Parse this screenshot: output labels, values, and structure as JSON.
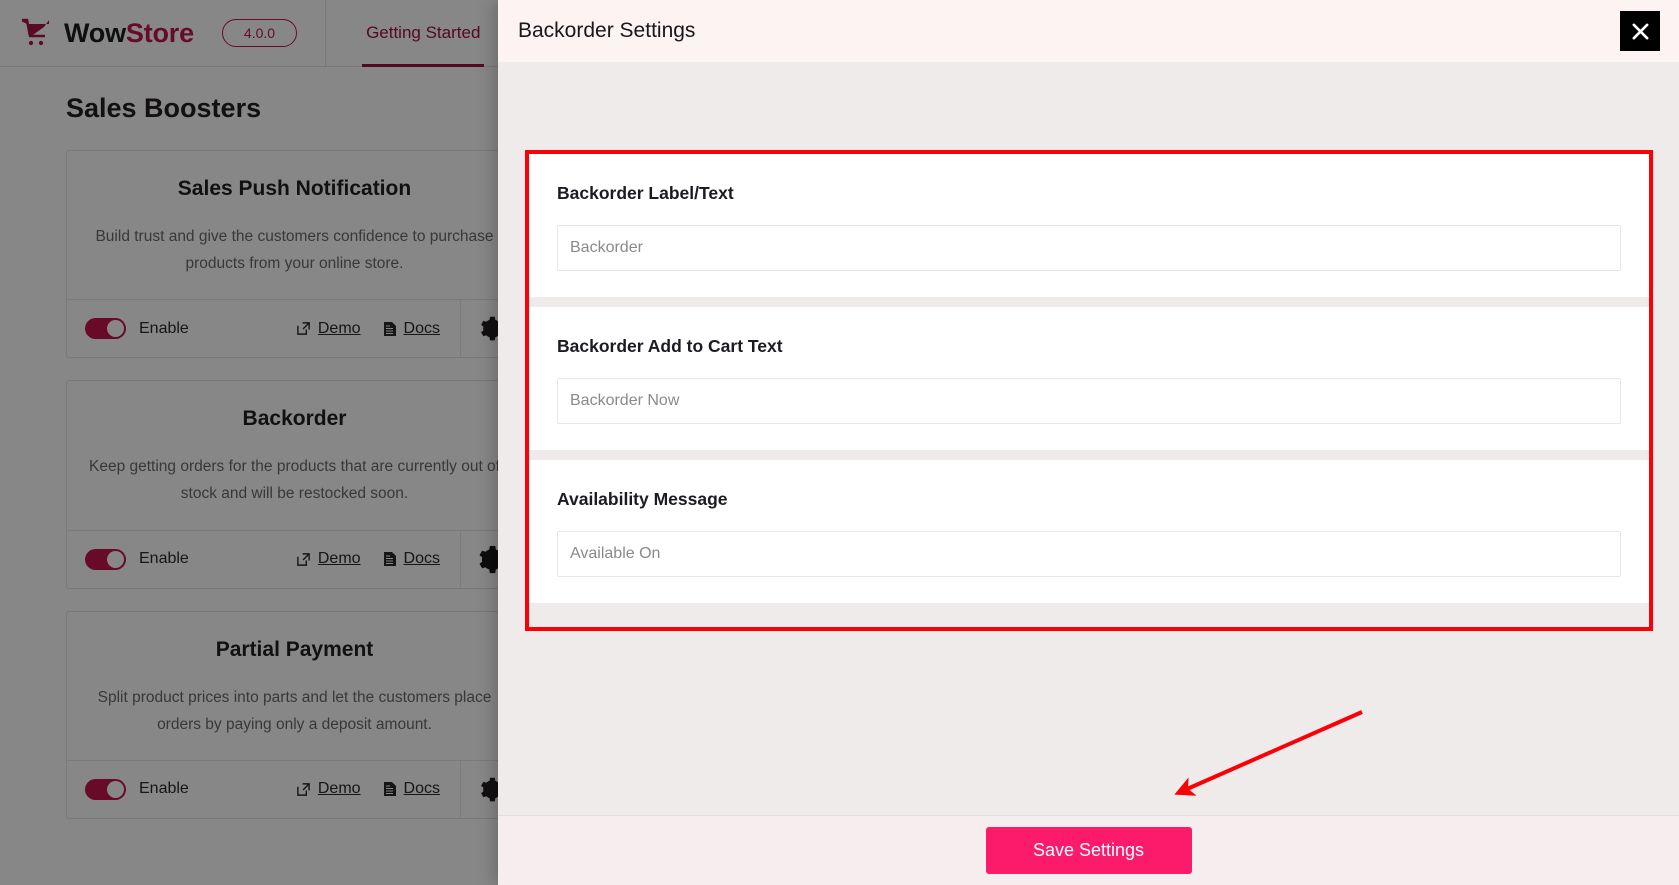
{
  "app": {
    "brand_prefix": "Wow",
    "brand_suffix": "Store",
    "version": "4.0.0",
    "logo_icon": "shopping-cart-icon",
    "nav_tabs": [
      {
        "label": "Getting Started",
        "active": true
      }
    ],
    "page_title": "Sales Boosters",
    "cards": [
      {
        "title": "Sales Push Notification",
        "description": "Build trust and give the customers confidence to purchase products from your online store.",
        "toggle_label": "Enable",
        "toggle_on": true,
        "demo_label": "Demo",
        "docs_label": "Docs",
        "demo_icon": "external-link-icon",
        "docs_icon": "document-icon",
        "settings_icon": "gear-icon"
      },
      {
        "title": "Backorder",
        "description": "Keep getting orders for the products that are currently out of stock and will be restocked soon.",
        "toggle_label": "Enable",
        "toggle_on": true,
        "demo_label": "Demo",
        "docs_label": "Docs",
        "demo_icon": "external-link-icon",
        "docs_icon": "document-icon",
        "settings_icon": "gear-icon"
      },
      {
        "title": "Partial Payment",
        "description": "Split product prices into parts and let the customers place orders by paying only a deposit amount.",
        "toggle_label": "Enable",
        "toggle_on": true,
        "demo_label": "Demo",
        "docs_label": "Docs",
        "demo_icon": "external-link-icon",
        "docs_icon": "document-icon",
        "settings_icon": "gear-icon"
      }
    ]
  },
  "modal": {
    "title": "Backorder Settings",
    "close_icon": "close-icon",
    "fields": [
      {
        "label": "Backorder Label/Text",
        "value": "",
        "placeholder": "Backorder"
      },
      {
        "label": "Backorder Add to Cart Text",
        "value": "",
        "placeholder": "Backorder Now"
      },
      {
        "label": "Availability Message",
        "value": "",
        "placeholder": "Available On"
      }
    ],
    "save_label": "Save Settings"
  },
  "annotations": {
    "highlight_box_color": "#fb0006",
    "arrow_color": "#fb0006",
    "arrow_points_to": "Save Settings"
  },
  "colors": {
    "brand_accent": "#c4154f",
    "save_button": "#fb1b6a",
    "modal_header_bg": "#fdf3f2",
    "modal_body_bg": "#f0ebeb",
    "annotation_red": "#fb0006"
  }
}
